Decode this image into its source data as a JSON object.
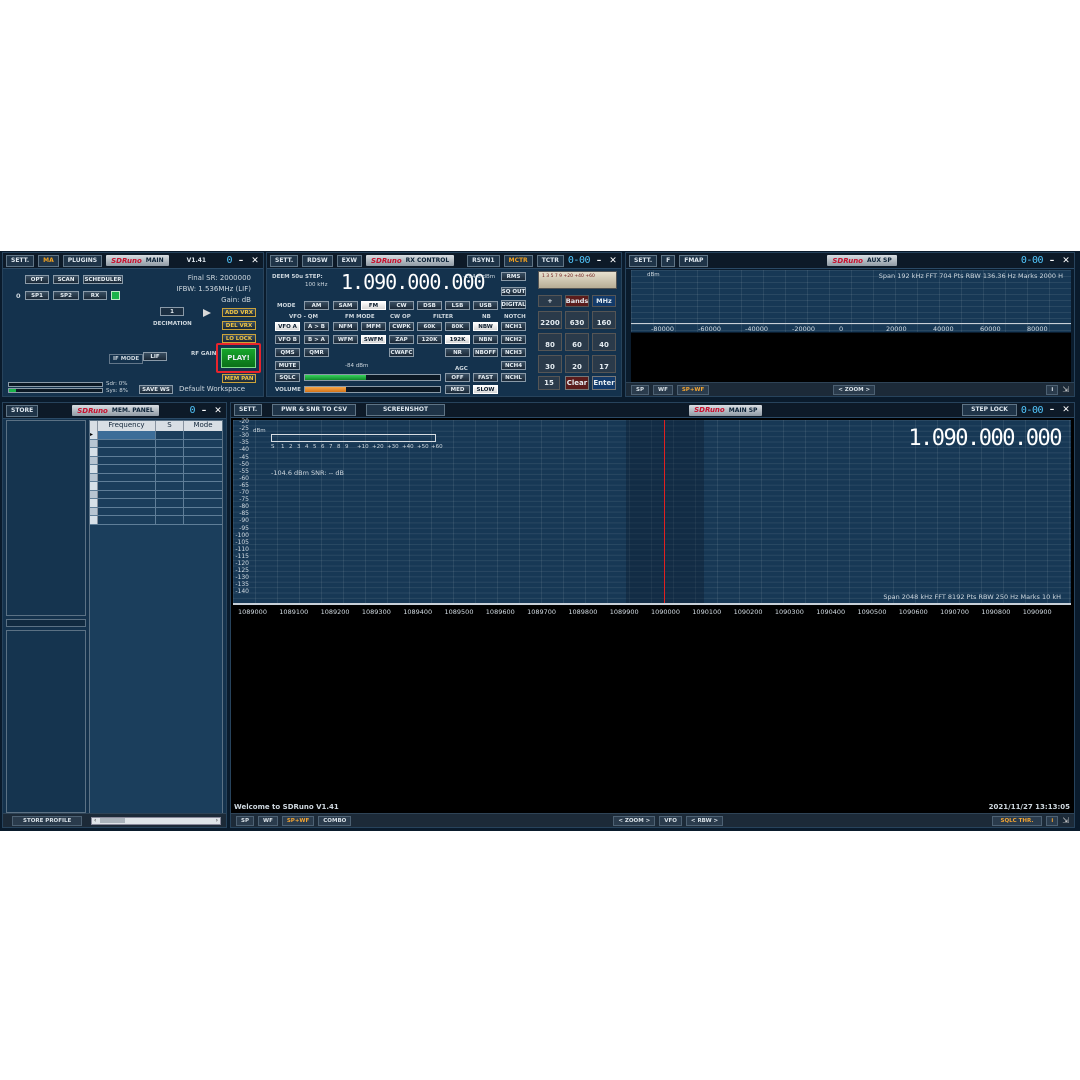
{
  "main_window": {
    "sett": "SETT.",
    "ma": "MA",
    "plugins": "PLUGINS",
    "logo": "SDRuno",
    "title": "MAIN",
    "version": "V1.41",
    "opt": "OPT",
    "scan": "SCAN",
    "scheduler": "SCHEDULER",
    "zero": "0",
    "sp1": "SP1",
    "sp2": "SP2",
    "rx": "RX",
    "final_sr": "Final SR: 2000000",
    "ifbw": "IFBW: 1.536MHz (LIF)",
    "gain": "Gain: dB",
    "decimation_value": "1",
    "decimation": "DECIMATION",
    "add_vrx": "ADD VRX",
    "del_vrx": "DEL VRX",
    "lo_lock": "LO LOCK",
    "if_mode": "IF MODE",
    "lif": "LIF",
    "rf_gain": "RF GAIN",
    "play": "PLAY!",
    "mem_pan": "MEM PAN",
    "sdr_cpu": "Sdr: 0%",
    "sys_cpu": "Sys: 8%",
    "save_ws": "SAVE WS",
    "workspace": "Default Workspace"
  },
  "rx_control": {
    "sett": "SETT.",
    "rdsw": "RDSW",
    "exw": "EXW",
    "logo": "SDRuno",
    "title": "RX CONTROL",
    "rsyn": "RSYN1",
    "mctr": "MCTR",
    "tctr": "TCTR",
    "deem": "DEEM 50u",
    "step_label": "STEP:",
    "step_value": "100 kHz",
    "frequency": "1.090.000.000",
    "level": "-104.6 dBm",
    "rms": "RMS",
    "sq_out": "SQ OUT",
    "digital": "DIGITAL",
    "mode": "MODE",
    "modes": [
      "AM",
      "SAM",
      "FM",
      "CW",
      "DSB",
      "LSB",
      "USB"
    ],
    "vfo_qm": "VFO - QM",
    "fm_mode": "FM MODE",
    "cw_op": "CW OP",
    "filter": "FILTER",
    "nb": "NB",
    "notch": "NOTCH",
    "vfo_a": "VFO A",
    "a_to_b": "A > B",
    "nfm": "NFM",
    "mfm": "MFM",
    "cwpk": "CWPK",
    "f60k": "60K",
    "f80k": "80K",
    "nbw": "NBW",
    "nch1": "NCH1",
    "vfo_b": "VFO B",
    "b_to_a": "B > A",
    "wfm": "WFM",
    "swfm": "SWFM",
    "zap": "ZAP",
    "f120k": "120K",
    "f192k": "192K",
    "nbn": "NBN",
    "nch2": "NCH2",
    "qms": "QMS",
    "qmr": "QMR",
    "cwafc": "CWAFC",
    "nr": "NR",
    "nboff": "NBOFF",
    "nch3": "NCH3",
    "mute": "MUTE",
    "smeter": "-84 dBm",
    "nch4": "NCH4",
    "sqlc": "SQLC",
    "agc": "AGC",
    "off": "OFF",
    "fast": "FAST",
    "nchl": "NCHL",
    "volume": "VOLUME",
    "med": "MED",
    "slow": "SLOW",
    "meter_scale": "1 3 5 7 9 +20 +40 +60",
    "keypad_top": [
      "+",
      "Bands",
      "MHz"
    ],
    "keypad": [
      "2200",
      "630",
      "160",
      "80",
      "60",
      "40",
      "30",
      "20",
      "17",
      "15"
    ],
    "clear": "Clear",
    "enter": "Enter"
  },
  "aux_sp": {
    "sett": "SETT.",
    "f": "F",
    "fmap": "FMAP",
    "logo": "SDRuno",
    "title": "AUX SP",
    "dbm": "dBm",
    "info": "Span 192 kHz   FFT 704 Pts   RBW 136.36 Hz   Marks 2000 H",
    "xticks": [
      "-80000",
      "-60000",
      "-40000",
      "-20000",
      "0",
      "20000",
      "40000",
      "60000",
      "80000"
    ],
    "sp": "SP",
    "wf": "WF",
    "spwf": "SP+WF",
    "zoom": "ZOOM",
    "i": "i"
  },
  "mem_panel": {
    "store": "STORE",
    "logo": "SDRuno",
    "title": "MEM. PANEL",
    "columns": [
      "Frequency",
      "S",
      "Mode"
    ],
    "store_profile": "STORE PROFILE"
  },
  "main_sp": {
    "sett": "SETT.",
    "pwr_snr": "PWR & SNR TO CSV",
    "screenshot": "SCREENSHOT",
    "logo": "SDRuno",
    "title": "MAIN SP",
    "step_lock": "STEP LOCK",
    "frequency": "1.090.000.000",
    "dbm": "dBm",
    "smeter_scale": [
      "S",
      "1",
      "2",
      "3",
      "4",
      "5",
      "6",
      "7",
      "8",
      "9",
      "+10",
      "+20",
      "+30",
      "+40",
      "+50",
      "+60"
    ],
    "readout": "-104.6 dBm   SNR: -- dB",
    "yticks": [
      "-20",
      "-25",
      "-30",
      "-35",
      "-40",
      "-45",
      "-50",
      "-55",
      "-60",
      "-65",
      "-70",
      "-75",
      "-80",
      "-85",
      "-90",
      "-95",
      "-100",
      "-105",
      "-110",
      "-115",
      "-120",
      "-125",
      "-130",
      "-135",
      "-140"
    ],
    "xticks": [
      "1089000",
      "1089100",
      "1089200",
      "1089300",
      "1089400",
      "1089500",
      "1089600",
      "1089700",
      "1089800",
      "1089900",
      "1090000",
      "1090100",
      "1090200",
      "1090300",
      "1090400",
      "1090500",
      "1090600",
      "1090700",
      "1090800",
      "1090900"
    ],
    "info": "Span 2048 kHz   FFT 8192 Pts   RBW 250 Hz   Marks 10 kH",
    "welcome": "Welcome to SDRuno V1.41",
    "timestamp": "2021/11/27 13:13:05",
    "sp": "SP",
    "wf": "WF",
    "spwf": "SP+WF",
    "combo": "COMBO",
    "zoom": "ZOOM",
    "vfo": "VFO",
    "rbw": "RBW",
    "sqlc_thr": "SQLC THR.",
    "i": "i"
  },
  "colors": {
    "accent": "#f0a020",
    "play_green": "#0c8a1e",
    "highlight_red": "#e8242c",
    "digits": "#53c9ff"
  }
}
